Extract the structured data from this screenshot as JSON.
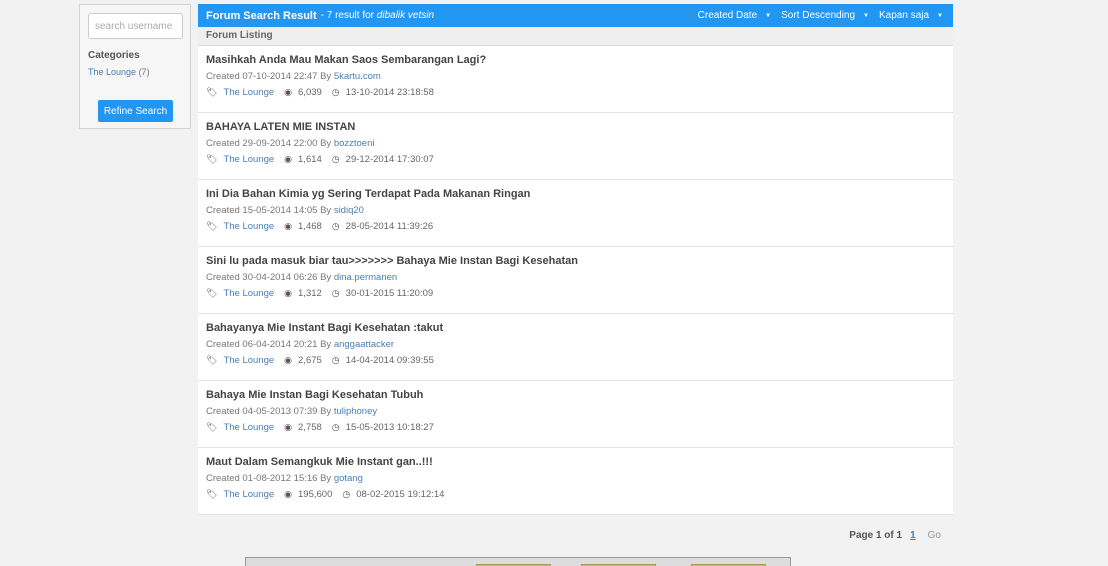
{
  "sidebar": {
    "search_placeholder": "search username",
    "categories_title": "Categories",
    "category_name": "The Lounge",
    "category_count": "(7)",
    "refine_label": "Refine Search"
  },
  "header": {
    "title": "Forum Search Result",
    "subtitle": "- 7 result for",
    "query": "dibalik vetsin",
    "sort_field": "Created Date",
    "sort_order": "Sort Descending",
    "time_filter": "Kapan saja"
  },
  "listing_label": "Forum Listing",
  "threads": [
    {
      "title": "Masihkah Anda Mau Makan Saos Sembarangan Lagi?",
      "created": "Created 07-10-2014 22:47 By",
      "author": "5kartu.com",
      "category": "The Lounge",
      "views": "6,039",
      "last_post": "13-10-2014 23:18:58"
    },
    {
      "title": "BAHAYA LATEN MIE INSTAN",
      "created": "Created 29-09-2014 22:00 By",
      "author": "bozztoeni",
      "category": "The Lounge",
      "views": "1,614",
      "last_post": "29-12-2014 17:30:07"
    },
    {
      "title": "Ini Dia Bahan Kimia yg Sering Terdapat Pada Makanan Ringan",
      "created": "Created 15-05-2014 14:05 By",
      "author": "sidiq20",
      "category": "The Lounge",
      "views": "1,468",
      "last_post": "28-05-2014 11:39:26"
    },
    {
      "title": "Sini lu pada masuk biar tau>>>>>>> Bahaya Mie Instan Bagi Kesehatan",
      "created": "Created 30-04-2014 06:26 By",
      "author": "dina.permanen",
      "category": "The Lounge",
      "views": "1,312",
      "last_post": "30-01-2015 11:20:09"
    },
    {
      "title": "Bahayanya Mie Instant Bagi Kesehatan :takut",
      "created": "Created 06-04-2014 20:21 By",
      "author": "anggaattacker",
      "category": "The Lounge",
      "views": "2,675",
      "last_post": "14-04-2014 09:39:55"
    },
    {
      "title": "Bahaya Mie Instan Bagi Kesehatan Tubuh",
      "created": "Created 04-05-2013 07:39 By",
      "author": "tuliphoney",
      "category": "The Lounge",
      "views": "2,758",
      "last_post": "15-05-2013 10:18:27"
    },
    {
      "title": "Maut Dalam Semangkuk Mie Instant gan..!!!",
      "created": "Created 01-08-2012 15:16 By",
      "author": "gotang",
      "category": "The Lounge",
      "views": "195,600",
      "last_post": "08-02-2015 19:12:14"
    }
  ],
  "pagination": {
    "label": "Page 1 of 1",
    "current": "1",
    "go": "Go"
  },
  "colors": {
    "header_bg": "#2196f3",
    "link": "#4a7eb5",
    "button": "#2196f3"
  }
}
